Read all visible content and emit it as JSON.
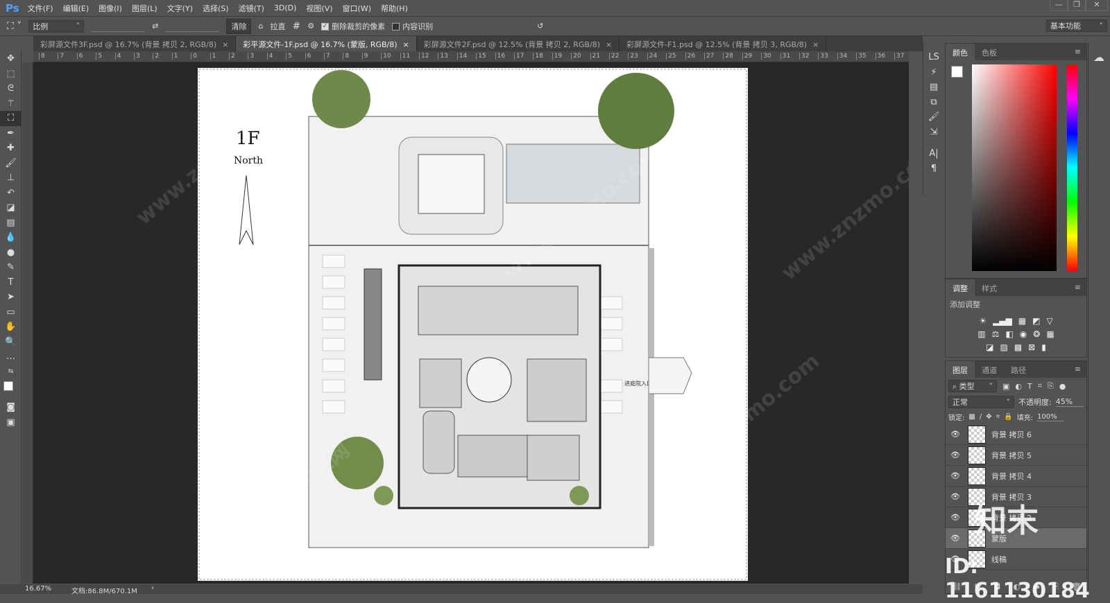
{
  "app": {
    "logo": "Ps"
  },
  "menu": [
    "文件(F)",
    "编辑(E)",
    "图像(I)",
    "图层(L)",
    "文字(Y)",
    "选择(S)",
    "滤镜(T)",
    "3D(D)",
    "视图(V)",
    "窗口(W)",
    "帮助(H)"
  ],
  "window_buttons": {
    "minimize": "—",
    "restore": "❐",
    "close": "✕"
  },
  "options": {
    "ratio": "比例",
    "clear": "清除",
    "straighten": "拉直",
    "delete_cropped": "删除裁剪的像素",
    "delete_cropped_checked": true,
    "content_aware": "内容识别",
    "content_aware_checked": false,
    "workspace": "基本功能"
  },
  "tabs": [
    {
      "label": "彩屏源文件3F.psd @ 16.7% (背景 拷贝 2, RGB/8)",
      "active": false
    },
    {
      "label": "彩平源文件-1F.psd @ 16.7% (蒙版, RGB/8)",
      "active": true
    },
    {
      "label": "彩屏源文件2F.psd @ 12.5% (背景 拷贝 2, RGB/8)",
      "active": false
    },
    {
      "label": "彩屏源文件-F1.psd @ 12.5% (背景 拷贝 3, RGB/8)",
      "active": false
    }
  ],
  "ruler_ticks": [
    "8",
    "7",
    "6",
    "5",
    "4",
    "3",
    "2",
    "1",
    "0",
    "1",
    "2",
    "3",
    "4",
    "5",
    "6",
    "7",
    "8",
    "9",
    "10",
    "11",
    "12",
    "13",
    "14",
    "15",
    "16",
    "17",
    "18",
    "19",
    "20",
    "21",
    "22",
    "23",
    "24",
    "25",
    "26",
    "27",
    "28",
    "29",
    "30",
    "31",
    "32",
    "33",
    "34",
    "35",
    "36",
    "37"
  ],
  "drawing": {
    "floor": "1F",
    "north": "North",
    "entrance": "进庭院入口方向"
  },
  "status": {
    "zoom": "16.67%",
    "doc": "文档:86.8M/670.1M",
    "arrow": "›"
  },
  "color_panel": {
    "tabs": [
      "颜色",
      "色板"
    ]
  },
  "adjust_panel": {
    "tabs": [
      "调整",
      "样式"
    ],
    "title": "添加调整"
  },
  "layers_panel": {
    "tabs": [
      "图层",
      "通道",
      "路径"
    ],
    "filter": "类型",
    "blend": "正常",
    "opacity_label": "不透明度:",
    "opacity": "45%",
    "lock_label": "锁定:",
    "fill_label": "填充:",
    "fill": "100%",
    "layers": [
      {
        "name": "背景 拷贝 6",
        "active": false
      },
      {
        "name": "背景 拷贝 5",
        "active": false
      },
      {
        "name": "背景 拷贝 4",
        "active": false
      },
      {
        "name": "背景 拷贝 3",
        "active": false
      },
      {
        "name": "背景 拷贝 2",
        "active": false
      },
      {
        "name": "蒙版",
        "active": true
      },
      {
        "name": "线稿",
        "active": false
      }
    ]
  },
  "watermark": {
    "brand": "知末",
    "id": "ID: 1161130184",
    "site": "www.znzmo.com",
    "site_cn": "知末网"
  }
}
